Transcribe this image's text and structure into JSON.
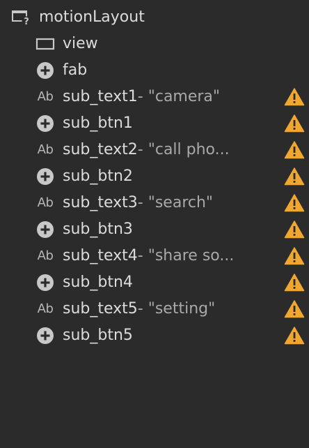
{
  "tree": {
    "root": {
      "label": "motionLayout",
      "icon": "layout-help-icon"
    },
    "items": [
      {
        "kind": "view",
        "label": "view",
        "suffix": "",
        "warning": false,
        "icon": "view-rect-icon"
      },
      {
        "kind": "button",
        "label": "fab",
        "suffix": "",
        "warning": false,
        "icon": "plus-circle-icon"
      },
      {
        "kind": "text",
        "label": "sub_text1",
        "suffix": "- \"camera\"",
        "warning": true,
        "icon": "text-ab-icon",
        "icon_text": "Ab"
      },
      {
        "kind": "button",
        "label": "sub_btn1",
        "suffix": "",
        "warning": true,
        "icon": "plus-circle-icon"
      },
      {
        "kind": "text",
        "label": "sub_text2",
        "suffix": "- \"call pho...",
        "warning": true,
        "icon": "text-ab-icon",
        "icon_text": "Ab"
      },
      {
        "kind": "button",
        "label": "sub_btn2",
        "suffix": "",
        "warning": true,
        "icon": "plus-circle-icon"
      },
      {
        "kind": "text",
        "label": "sub_text3",
        "suffix": "- \"search\"",
        "warning": true,
        "icon": "text-ab-icon",
        "icon_text": "Ab"
      },
      {
        "kind": "button",
        "label": "sub_btn3",
        "suffix": "",
        "warning": true,
        "icon": "plus-circle-icon"
      },
      {
        "kind": "text",
        "label": "sub_text4",
        "suffix": "- \"share so...",
        "warning": true,
        "icon": "text-ab-icon",
        "icon_text": "Ab"
      },
      {
        "kind": "button",
        "label": "sub_btn4",
        "suffix": "",
        "warning": true,
        "icon": "plus-circle-icon"
      },
      {
        "kind": "text",
        "label": "sub_text5",
        "suffix": "- \"setting\"",
        "warning": true,
        "icon": "text-ab-icon",
        "icon_text": "Ab"
      },
      {
        "kind": "button",
        "label": "sub_btn5",
        "suffix": "",
        "warning": true,
        "icon": "plus-circle-icon"
      }
    ]
  },
  "colors": {
    "background": "#2b2b2b",
    "text": "#dcdcdc",
    "suffix_text": "#a9a9a9",
    "icon": "#c8c8c8",
    "warning": "#f0a732"
  }
}
